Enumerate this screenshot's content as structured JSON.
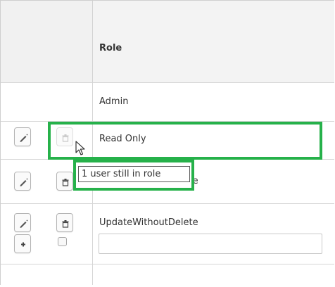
{
  "table": {
    "header": {
      "role_label": "Role"
    },
    "rows": [
      {
        "role": "Admin"
      },
      {
        "role": "Read Only"
      },
      {
        "role": "UpdateWithoutDelete"
      },
      {
        "role": "UpdateWithoutDelete"
      }
    ],
    "new_row": {
      "role_value": ""
    }
  },
  "tooltip": {
    "text": "1 user still in role"
  },
  "colors": {
    "highlight": "#26b14a",
    "border": "#d6d6d6",
    "header_bg": "#f3f3f3"
  },
  "icons": {
    "edit": "pencil-icon",
    "delete": "trash-icon",
    "add": "plus-icon",
    "cursor": "mouse-pointer-icon"
  }
}
